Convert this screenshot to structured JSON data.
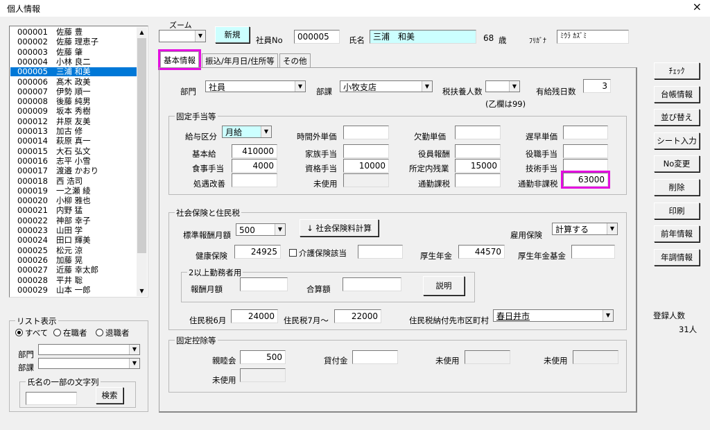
{
  "window": {
    "title": "個人情報",
    "close": "×"
  },
  "employees": [
    {
      "code": "000001",
      "name": "佐藤 豊"
    },
    {
      "code": "000002",
      "name": "佐藤 理恵子"
    },
    {
      "code": "000003",
      "name": "佐藤 肇"
    },
    {
      "code": "000004",
      "name": "小林 良二"
    },
    {
      "code": "000005",
      "name": "三浦 和美"
    },
    {
      "code": "000006",
      "name": "髙木 政美"
    },
    {
      "code": "000007",
      "name": "伊勢 順一"
    },
    {
      "code": "000008",
      "name": "後藤 純男"
    },
    {
      "code": "000009",
      "name": "坂本 秀樹"
    },
    {
      "code": "000012",
      "name": "井原 友美"
    },
    {
      "code": "000013",
      "name": "加古 修"
    },
    {
      "code": "000014",
      "name": "萩原 真一"
    },
    {
      "code": "000015",
      "name": "大石 弘文"
    },
    {
      "code": "000016",
      "name": "志平 小雪"
    },
    {
      "code": "000017",
      "name": "渡邉 かおり"
    },
    {
      "code": "000018",
      "name": "西 浩司"
    },
    {
      "code": "000019",
      "name": "一之瀬 綾"
    },
    {
      "code": "000020",
      "name": "小柳 雅也"
    },
    {
      "code": "000021",
      "name": "内野 猛"
    },
    {
      "code": "000022",
      "name": "神部 幸子"
    },
    {
      "code": "000023",
      "name": "山田 学"
    },
    {
      "code": "000024",
      "name": "田口 輝美"
    },
    {
      "code": "000025",
      "name": "松元 涼"
    },
    {
      "code": "000026",
      "name": "加藤 晃"
    },
    {
      "code": "000027",
      "name": "近藤 幸太郎"
    },
    {
      "code": "000028",
      "name": "平井 聡"
    },
    {
      "code": "000029",
      "name": "山本 一郎"
    }
  ],
  "selected_index": 4,
  "list_filter": {
    "caption": "リスト表示",
    "options": [
      "すべて",
      "在職者",
      "退職者"
    ],
    "dept_label": "部門",
    "section_label": "部課",
    "name_search_caption": "氏名の一部の文字列",
    "search_button": "検索"
  },
  "header": {
    "zoom_label": "ズーム",
    "new_button": "新規",
    "emp_no_label": "社員No",
    "emp_no": "000005",
    "name_label": "氏名",
    "name": "三浦　和美",
    "age": "68",
    "age_unit": "歳",
    "kana_label": "ﾌﾘｶﾞﾅ",
    "kana": "ﾐｳﾗ ｶｽﾞﾐ"
  },
  "tabs": [
    "基本情報",
    "振込/年月日/住所等",
    "その他"
  ],
  "basic": {
    "dept_label": "部門",
    "dept": "社員",
    "section_label": "部課",
    "section": "小牧支店",
    "dependents_label": "税扶養人数",
    "dependents_note": "(乙欄は99)",
    "paid_leave_label": "有給残日数",
    "paid_leave": "3"
  },
  "allowances": {
    "caption": "固定手当等",
    "pay_type_label": "給与区分",
    "pay_type": "月給",
    "overtime_label": "時間外単価",
    "absence_label": "欠勤単価",
    "late_label": "遅早単価",
    "base_label": "基本給",
    "base": "410000",
    "family_label": "家族手当",
    "family": "",
    "officer_label": "役員報酬",
    "officer": "",
    "position_label": "役職手当",
    "position": "",
    "meal_label": "食事手当",
    "meal": "4000",
    "qualification_label": "資格手当",
    "qualification": "10000",
    "scheduled_ot_label": "所定内残業",
    "scheduled_ot": "15000",
    "tech_label": "技術手当",
    "tech": "",
    "treatment_label": "処遇改善",
    "unused_label": "未使用",
    "commute_tax_label": "通勤課税",
    "commute_nontax_label": "通勤非課税",
    "commute_nontax": "63000"
  },
  "social": {
    "caption": "社会保険と住民税",
    "std_label": "標準報酬月額",
    "std": "500",
    "calc_button": "↓ 社会保険料計算",
    "employment_label": "雇用保険",
    "employment": "計算する",
    "health_label": "健康保険",
    "health": "24925",
    "care_label": "介護保険該当",
    "pension_label": "厚生年金",
    "pension": "44570",
    "pension_fund_label": "厚生年金基金",
    "dual_caption": "2以上勤務者用",
    "dual_monthly_label": "報酬月額",
    "dual_total_label": "合算額",
    "explain_button": "説明",
    "res_jun_label": "住民税6月",
    "res_jun": "24000",
    "res_jul_label": "住民税7月～",
    "res_jul": "22000",
    "res_city_label": "住民税納付先市区町村",
    "res_city": "春日井市"
  },
  "deductions": {
    "caption": "固定控除等",
    "social_club_label": "親睦会",
    "social_club": "500",
    "loan_label": "貸付金",
    "unused_label": "未使用"
  },
  "right_buttons": [
    "ﾁｪｯｸ",
    "台帳情報",
    "並び替え",
    "シート入力",
    "No変更",
    "削除",
    "印刷",
    "前年情報",
    "年調情報"
  ],
  "registered": {
    "label": "登録人数",
    "count": "31人"
  }
}
